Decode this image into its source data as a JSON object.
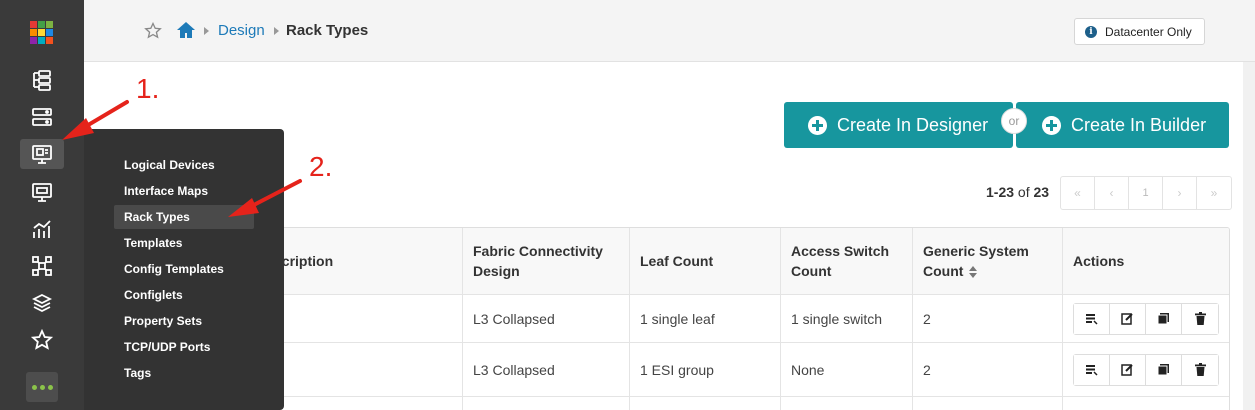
{
  "rail": {
    "icons": [
      "logo-icon",
      "device-tree-icon",
      "server-rack-icon",
      "design-monitor-icon",
      "monitor-icon",
      "analytics-chart-icon",
      "topology-icon",
      "layers-icon",
      "star-icon",
      "more-icon"
    ],
    "colors": {
      "background": "#3a3a3a",
      "more_dots": "#8bc34a"
    }
  },
  "header": {
    "breadcrumb": {
      "parent": "Design",
      "current": "Rack Types"
    },
    "badge": "Datacenter Only"
  },
  "toolbar": {
    "create_designer_label": "Create In Designer",
    "or_label": "or",
    "create_builder_label": "Create In Builder",
    "accent": "#17969e"
  },
  "pagination": {
    "range": "1-23",
    "of_label": "of",
    "total": "23",
    "first": "«",
    "prev": "‹",
    "page": "1",
    "next": "›",
    "last": "»"
  },
  "table": {
    "columns": [
      "scription",
      "Fabric Connectivity Design",
      "Leaf Count",
      "Access Switch Count",
      "Generic System Count",
      "Actions"
    ],
    "rows": [
      {
        "description": "",
        "fabric": "L3 Collapsed",
        "leaf": "1 single leaf",
        "access": "1 single switch",
        "generic": "2"
      },
      {
        "description": "",
        "fabric": "L3 Collapsed",
        "leaf": "1 ESI group",
        "access": "None",
        "generic": "2"
      }
    ],
    "action_icons": [
      "view-icon",
      "edit-icon",
      "clone-icon",
      "delete-icon"
    ]
  },
  "flyout": {
    "items": [
      "Logical Devices",
      "Interface Maps",
      "Rack Types",
      "Templates",
      "Config Templates",
      "Configlets",
      "Property Sets",
      "TCP/UDP Ports",
      "Tags"
    ],
    "active": "Rack Types"
  },
  "annotations": {
    "step1": "1.",
    "step2": "2.",
    "color": "#e5231b"
  }
}
